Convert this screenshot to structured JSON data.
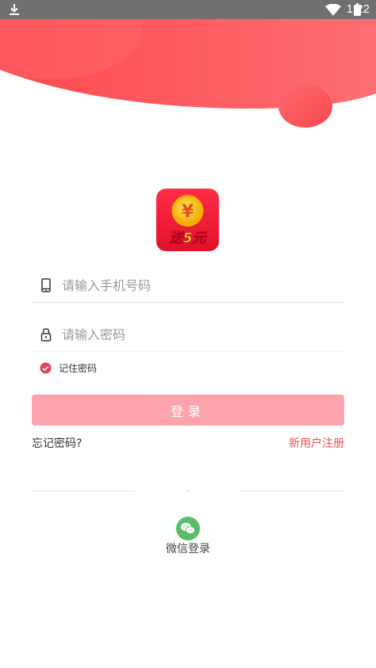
{
  "status_bar": {
    "time": "1:22",
    "icons": [
      "download-icon",
      "wifi-icon",
      "battery-icon"
    ]
  },
  "colors": {
    "brand_red": "#f0504b",
    "header_red": "#fb4f55",
    "button_pink": "#fca3ad",
    "check_red": "#e04456",
    "wechat_green": "#5bbd6a"
  },
  "logo": {
    "symbol": "¥",
    "caption": "送5元"
  },
  "form": {
    "phone_placeholder": "请输入手机号码",
    "password_placeholder": "请输入密码",
    "remember_label": "记住密码",
    "remember_checked": true,
    "login_label": "登录"
  },
  "links": {
    "forgot": "忘记密码?",
    "register": "新用户注册"
  },
  "wechat": {
    "label": "微信登录"
  }
}
